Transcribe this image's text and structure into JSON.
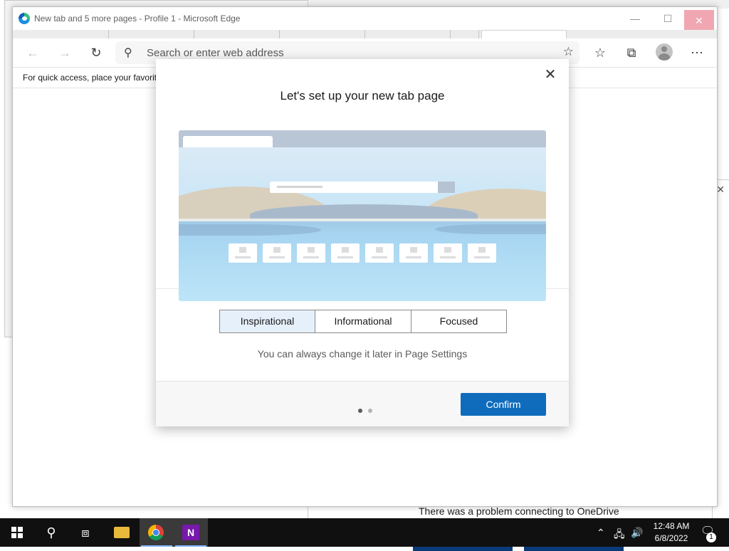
{
  "window": {
    "title": "New tab and 5 more pages - Profile 1 - Microsoft Edge",
    "minimize_icon": "minimize-icon",
    "maximize_icon": "maximize-icon",
    "close_icon": "close-icon"
  },
  "toolbar": {
    "back_icon": "back-arrow-icon",
    "forward_icon": "forward-arrow-icon",
    "refresh_icon": "refresh-icon",
    "address_placeholder": "Search or enter web address",
    "add_favorite_icon": "add-favorite-icon",
    "favorites_icon": "favorites-icon",
    "collections_icon": "collections-icon",
    "profile_icon": "profile-avatar",
    "more_icon": "more-icon"
  },
  "favorites_bar": {
    "text": "For quick access, place your favorit"
  },
  "dialog": {
    "title": "Let's set up your new tab page",
    "close_icon": "close-icon",
    "layout_options": [
      {
        "label": "Inspirational",
        "selected": true
      },
      {
        "label": "Informational",
        "selected": false
      },
      {
        "label": "Focused",
        "selected": false
      }
    ],
    "hint": "You can always change it later in Page Settings",
    "pager": {
      "current": 1,
      "total": 2
    },
    "confirm_label": "Confirm",
    "accent_color": "#0f6cbd"
  },
  "background": {
    "onedrive_message": "There was a problem connecting to OneDrive"
  },
  "taskbar": {
    "items": [
      {
        "name": "start-icon"
      },
      {
        "name": "search-icon"
      },
      {
        "name": "task-view-icon"
      },
      {
        "name": "file-explorer-icon"
      },
      {
        "name": "chrome-icon"
      },
      {
        "name": "onenote-icon"
      }
    ],
    "tray_icons": [
      "chevron-up-icon",
      "network-icon",
      "volume-icon"
    ],
    "time": "12:48 AM",
    "date": "6/8/2022",
    "notification_count": "1"
  }
}
